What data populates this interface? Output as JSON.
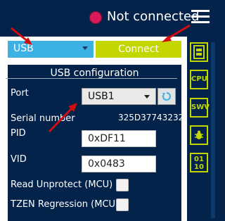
{
  "header": {
    "status_text": "Not connected",
    "status_color": "#d8195a"
  },
  "toolbar": {
    "interface_value": "USB",
    "connect_label": "Connect"
  },
  "config": {
    "title": "USB configuration",
    "port_label": "Port",
    "port_value": "USB1",
    "serial_label": "Serial number",
    "serial_value": "325D37743232",
    "pid_label": "PID",
    "pid_value": "0xDF11",
    "vid_label": "VID",
    "vid_value": "0x0483",
    "read_unprotect_label": "Read Unprotect (MCU)",
    "tzen_label": "TZEN Regression (MCU)"
  },
  "sidebar": {
    "items": [
      {
        "icon": "memory-file-icon",
        "text": ""
      },
      {
        "icon": "cpu-icon",
        "text": "CPU"
      },
      {
        "icon": "swv-icon",
        "text": "SWV"
      },
      {
        "icon": "bug-icon",
        "text": ""
      },
      {
        "icon": "binary-icon",
        "text": "01\n10"
      }
    ]
  },
  "colors": {
    "accent": "#c4d600",
    "background": "#03234b",
    "interface": "#3bb1e4"
  }
}
